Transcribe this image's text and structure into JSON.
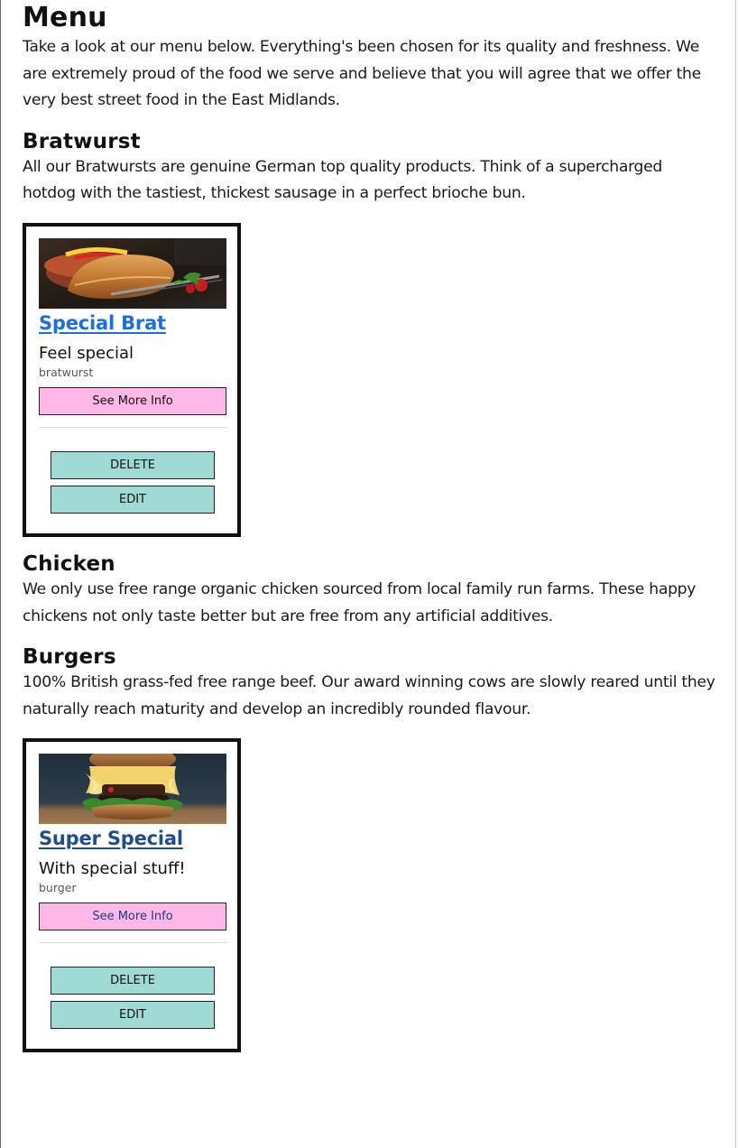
{
  "menu": {
    "title": "Menu",
    "intro": "Take a look at our menu below. Everything's been chosen for its quality and freshness. We are extremely proud of the food we serve and believe that you will agree that we offer the very best street food in the East Midlands."
  },
  "sections": [
    {
      "title": "Bratwurst",
      "description": "All our Bratwursts are genuine German top quality products. Think of a supercharged hotdog with the tastiest, thickest sausage in a perfect brioche bun.",
      "items": [
        {
          "title": "Special Brat",
          "subtitle": "Feel special",
          "category": "bratwurst",
          "more_label": "See More Info",
          "delete_label": "DELETE",
          "edit_label": "EDIT"
        }
      ]
    },
    {
      "title": "Chicken",
      "description": "We only use free range organic chicken sourced from local family run farms. These happy chickens not only taste better but are free from any artificial additives.",
      "items": []
    },
    {
      "title": "Burgers",
      "description": "100% British grass-fed free range beef. Our award winning cows are slowly reared until they naturally reach maturity and develop an incredibly rounded flavour.",
      "items": [
        {
          "title": "Super Special",
          "subtitle": "With special stuff!",
          "category": "burger",
          "more_label": "See More Info",
          "delete_label": "DELETE",
          "edit_label": "EDIT"
        }
      ]
    }
  ],
  "colors": {
    "more_button_bg": "#ffb8e8",
    "action_button_bg": "#9fdad4",
    "link_blue": "#1e6ee0",
    "link_navy": "#1f4f8a"
  }
}
